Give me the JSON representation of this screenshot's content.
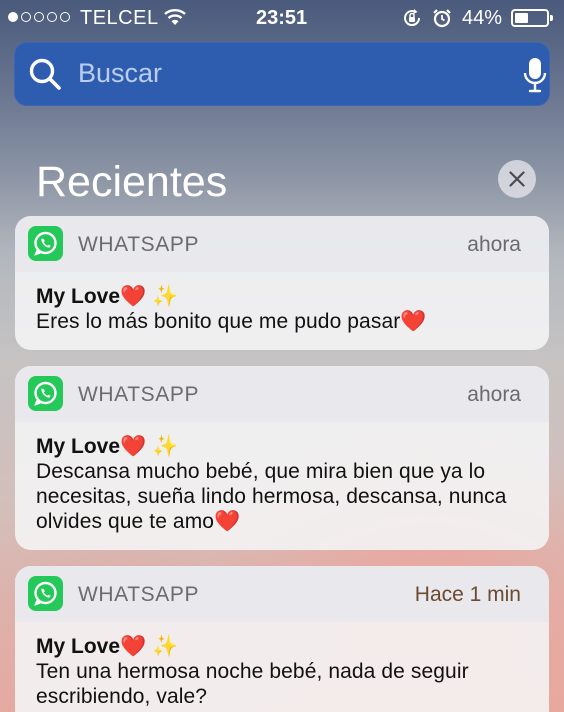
{
  "status_bar": {
    "carrier": "TELCEL",
    "time": "23:51",
    "battery": "44%",
    "battery_level": 0.44
  },
  "search": {
    "placeholder": "Buscar"
  },
  "section": {
    "title": "Recientes"
  },
  "notifications": [
    {
      "app": "WHATSAPP",
      "time": "ahora",
      "sender": "My Love❤️ ✨",
      "message": "Eres lo más bonito que me pudo pasar❤️"
    },
    {
      "app": "WHATSAPP",
      "time": "ahora",
      "sender": "My Love❤️ ✨",
      "message": "Descansa mucho bebé, que mira bien que ya lo necesitas, sueña lindo hermosa, descansa, nunca olvides que te amo❤️"
    },
    {
      "app": "WHATSAPP",
      "time": "Hace 1 min",
      "sender": "My Love❤️ ✨",
      "message": "Ten una hermosa noche bebé, nada de seguir escribiendo, vale?"
    }
  ],
  "icons": {
    "signal": "signal-dots-icon",
    "wifi": "wifi-icon",
    "rotation_lock": "rotation-lock-icon",
    "alarm": "alarm-icon",
    "battery": "battery-icon",
    "search": "search-icon",
    "mic": "microphone-icon",
    "clear": "close-icon",
    "app": "whatsapp-icon"
  },
  "colors": {
    "search_bar": "#2e5db0",
    "whatsapp_green": "#25c95a"
  }
}
